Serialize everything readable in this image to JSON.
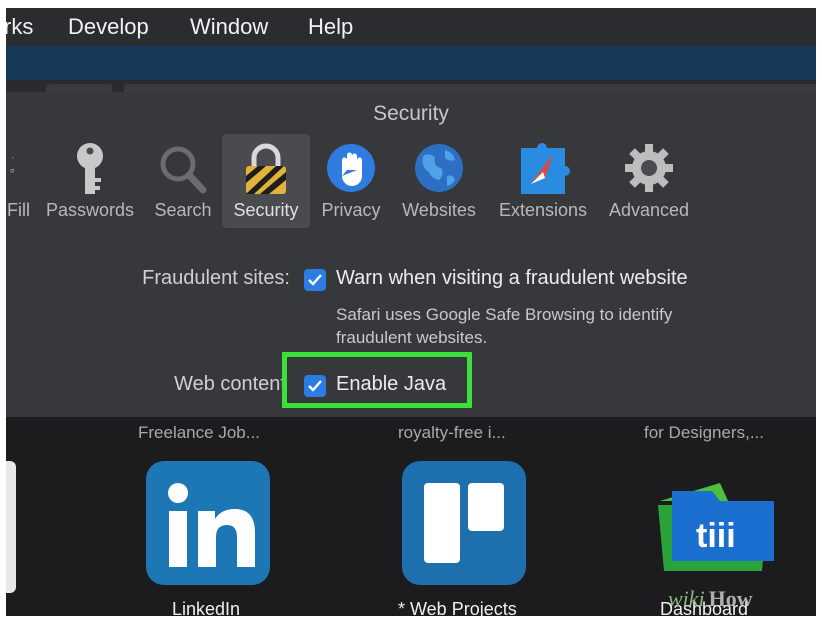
{
  "menubar": {
    "items": [
      "rks",
      "Develop",
      "Window",
      "Help"
    ]
  },
  "prefs": {
    "title": "Security",
    "tabs": [
      {
        "label": "Fill",
        "icon": "autofill-icon"
      },
      {
        "label": "Passwords",
        "icon": "key-icon"
      },
      {
        "label": "Search",
        "icon": "magnifier-icon"
      },
      {
        "label": "Security",
        "icon": "lock-icon",
        "selected": true
      },
      {
        "label": "Privacy",
        "icon": "hand-icon"
      },
      {
        "label": "Websites",
        "icon": "globe-icon"
      },
      {
        "label": "Extensions",
        "icon": "puzzle-compass-icon"
      },
      {
        "label": "Advanced",
        "icon": "gear-icon"
      }
    ],
    "fraudulent": {
      "label": "Fraudulent sites:",
      "checkbox_text": "Warn when visiting a fraudulent website",
      "checked": true,
      "description_line1": "Safari uses Google Safe Browsing to identify",
      "description_line2": "fraudulent websites."
    },
    "web_content": {
      "label": "Web content",
      "checkbox_text": "Enable Java",
      "checked": true
    }
  },
  "favorites": {
    "top_labels": [
      "Freelance Job...",
      "royalty-free i...",
      "for Designers,..."
    ],
    "items": [
      {
        "label": "LinkedIn",
        "icon": "linkedin-icon"
      },
      {
        "label": "* Web Projects",
        "icon": "trello-icon"
      },
      {
        "label": "Dashboard",
        "icon": "dashboard-folder-icon"
      }
    ]
  },
  "watermark": {
    "part1": "wiki",
    "part2": "How"
  },
  "colors": {
    "highlight": "#3ae13a",
    "checkbox": "#2a7de1",
    "linkedin": "#1e77b5",
    "trello": "#1e6fae",
    "window": "#37383b"
  }
}
